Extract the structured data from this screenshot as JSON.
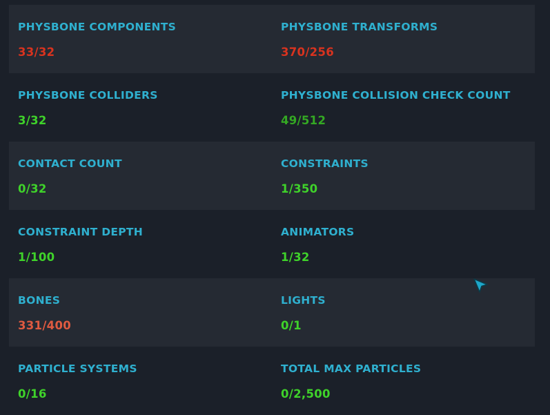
{
  "rows": [
    {
      "left": {
        "label": "PHYSBONE COMPONENTS",
        "value": "33/32"
      },
      "right": {
        "label": "PHYSBONE TRANSFORMS",
        "value": "370/256"
      }
    },
    {
      "left": {
        "label": "PHYSBONE COLLIDERS",
        "value": "3/32"
      },
      "right": {
        "label": "PHYSBONE COLLISION CHECK COUNT",
        "value": "49/512"
      }
    },
    {
      "left": {
        "label": "CONTACT COUNT",
        "value": "0/32"
      },
      "right": {
        "label": "CONSTRAINTS",
        "value": "1/350"
      }
    },
    {
      "left": {
        "label": "CONSTRAINT DEPTH",
        "value": "1/100"
      },
      "right": {
        "label": "ANIMATORS",
        "value": "1/32"
      }
    },
    {
      "left": {
        "label": "BONES",
        "value": "331/400"
      },
      "right": {
        "label": "LIGHTS",
        "value": "0/1"
      }
    },
    {
      "left": {
        "label": "PARTICLE SYSTEMS",
        "value": "0/16"
      },
      "right": {
        "label": "TOTAL MAX PARTICLES",
        "value": "0/2,500"
      }
    }
  ],
  "colors": {
    "background": "#1b2029",
    "row_shaded": "#252a33",
    "label": "#2fb0cf",
    "over_limit": "#d8331f",
    "near_limit": "#df5a40",
    "ok": "#3fd22a",
    "ok_dim": "#34a823",
    "cursor": "#1ea6c9"
  },
  "icons": {
    "cursor": "mouse-pointer-arrow-icon"
  }
}
